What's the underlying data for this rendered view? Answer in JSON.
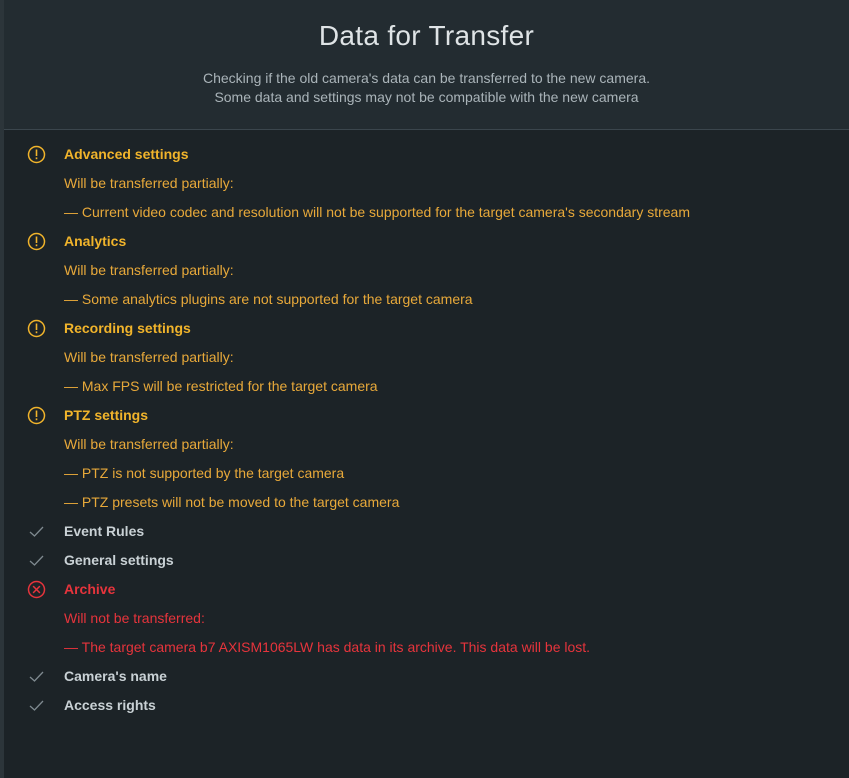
{
  "header": {
    "title": "Data for Transfer",
    "subtitle_line1": "Checking if the old camera's data can be transferred to the new camera.",
    "subtitle_line2": "Some data and settings may not be compatible with the new camera"
  },
  "colors": {
    "warning": "#f1b42b",
    "error": "#e6343c",
    "ok": "#c9d1d5",
    "background": "#1c2327"
  },
  "items": [
    {
      "status": "warning",
      "icon": "warning-circle-icon",
      "title": "Advanced settings",
      "summary": "Will be transferred partially:",
      "details": [
        "— Current video codec and resolution will not be supported for the target camera's secondary stream"
      ]
    },
    {
      "status": "warning",
      "icon": "warning-circle-icon",
      "title": "Analytics",
      "summary": "Will be transferred partially:",
      "details": [
        "— Some analytics plugins are not supported for the target camera"
      ]
    },
    {
      "status": "warning",
      "icon": "warning-circle-icon",
      "title": "Recording settings",
      "summary": "Will be transferred partially:",
      "details": [
        "— Max FPS will be restricted for the target camera"
      ]
    },
    {
      "status": "warning",
      "icon": "warning-circle-icon",
      "title": "PTZ settings",
      "summary": "Will be transferred partially:",
      "details": [
        "— PTZ is not supported by the target camera",
        "— PTZ presets will not be moved to the target camera"
      ]
    },
    {
      "status": "ok",
      "icon": "checkmark-icon",
      "title": "Event Rules"
    },
    {
      "status": "ok",
      "icon": "checkmark-icon",
      "title": "General settings"
    },
    {
      "status": "error",
      "icon": "error-circle-icon",
      "title": "Archive",
      "summary": "Will not be transferred:",
      "details": [
        "— The target camera b7 AXISM1065LW has data in its archive. This data will be lost."
      ]
    },
    {
      "status": "ok",
      "icon": "checkmark-icon",
      "title": "Camera's name"
    },
    {
      "status": "ok",
      "icon": "checkmark-icon",
      "title": "Access rights"
    }
  ]
}
